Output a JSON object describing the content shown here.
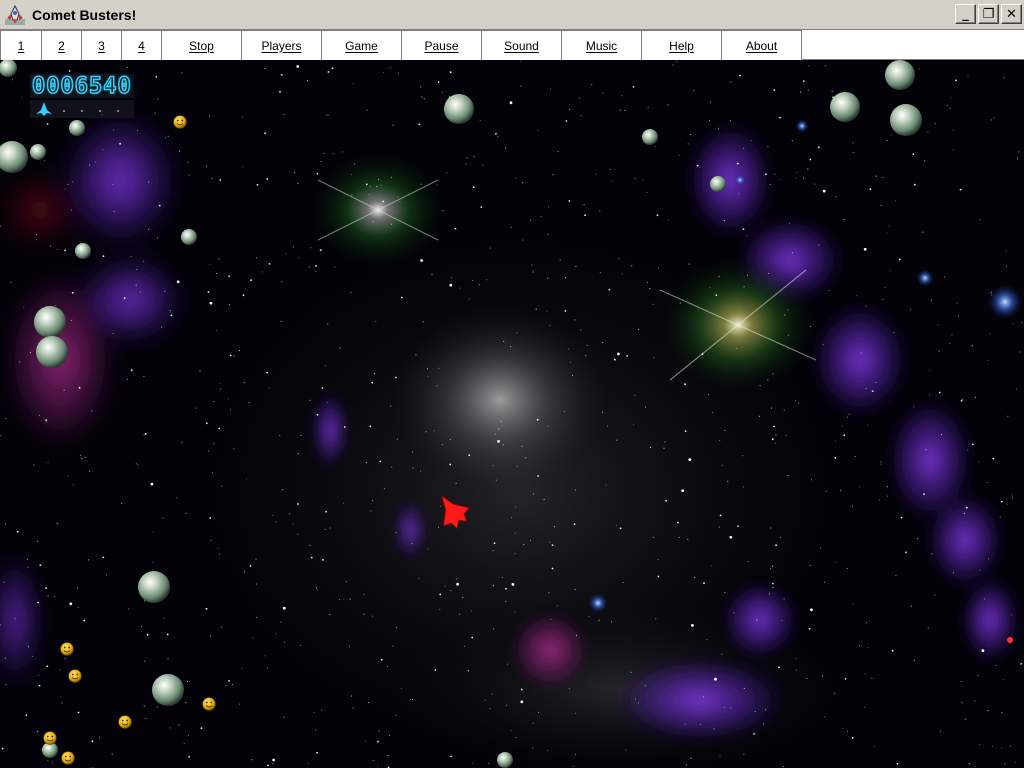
{
  "window": {
    "title": "Comet Busters!",
    "controls": {
      "minimize": "_",
      "restore": "❐",
      "close": "✕"
    }
  },
  "menu": {
    "buttons": [
      {
        "label": "1",
        "key": "1"
      },
      {
        "label": "2",
        "key": "2"
      },
      {
        "label": "3",
        "key": "3"
      },
      {
        "label": "4",
        "key": "4"
      },
      {
        "label": "Stop",
        "key": "S"
      },
      {
        "label": "Players",
        "key": "P"
      },
      {
        "label": "Game",
        "key": "G"
      },
      {
        "label": "Pause",
        "key": "P"
      },
      {
        "label": "Sound",
        "key": "S"
      },
      {
        "label": "Music",
        "key": "M"
      },
      {
        "label": "Help",
        "key": "H"
      },
      {
        "label": "About",
        "key": "A"
      }
    ]
  },
  "hud": {
    "score": "0006540",
    "score_color": "#2ed0ff",
    "ship_icon": "player-ship-icon"
  },
  "colors": {
    "player_ship": "#ff1a1a",
    "hud_ship": "#2ed0ff",
    "smiley": "#f2c200",
    "nebula_purple": "#7a2ad8",
    "nebula_magenta": "#c02090"
  }
}
